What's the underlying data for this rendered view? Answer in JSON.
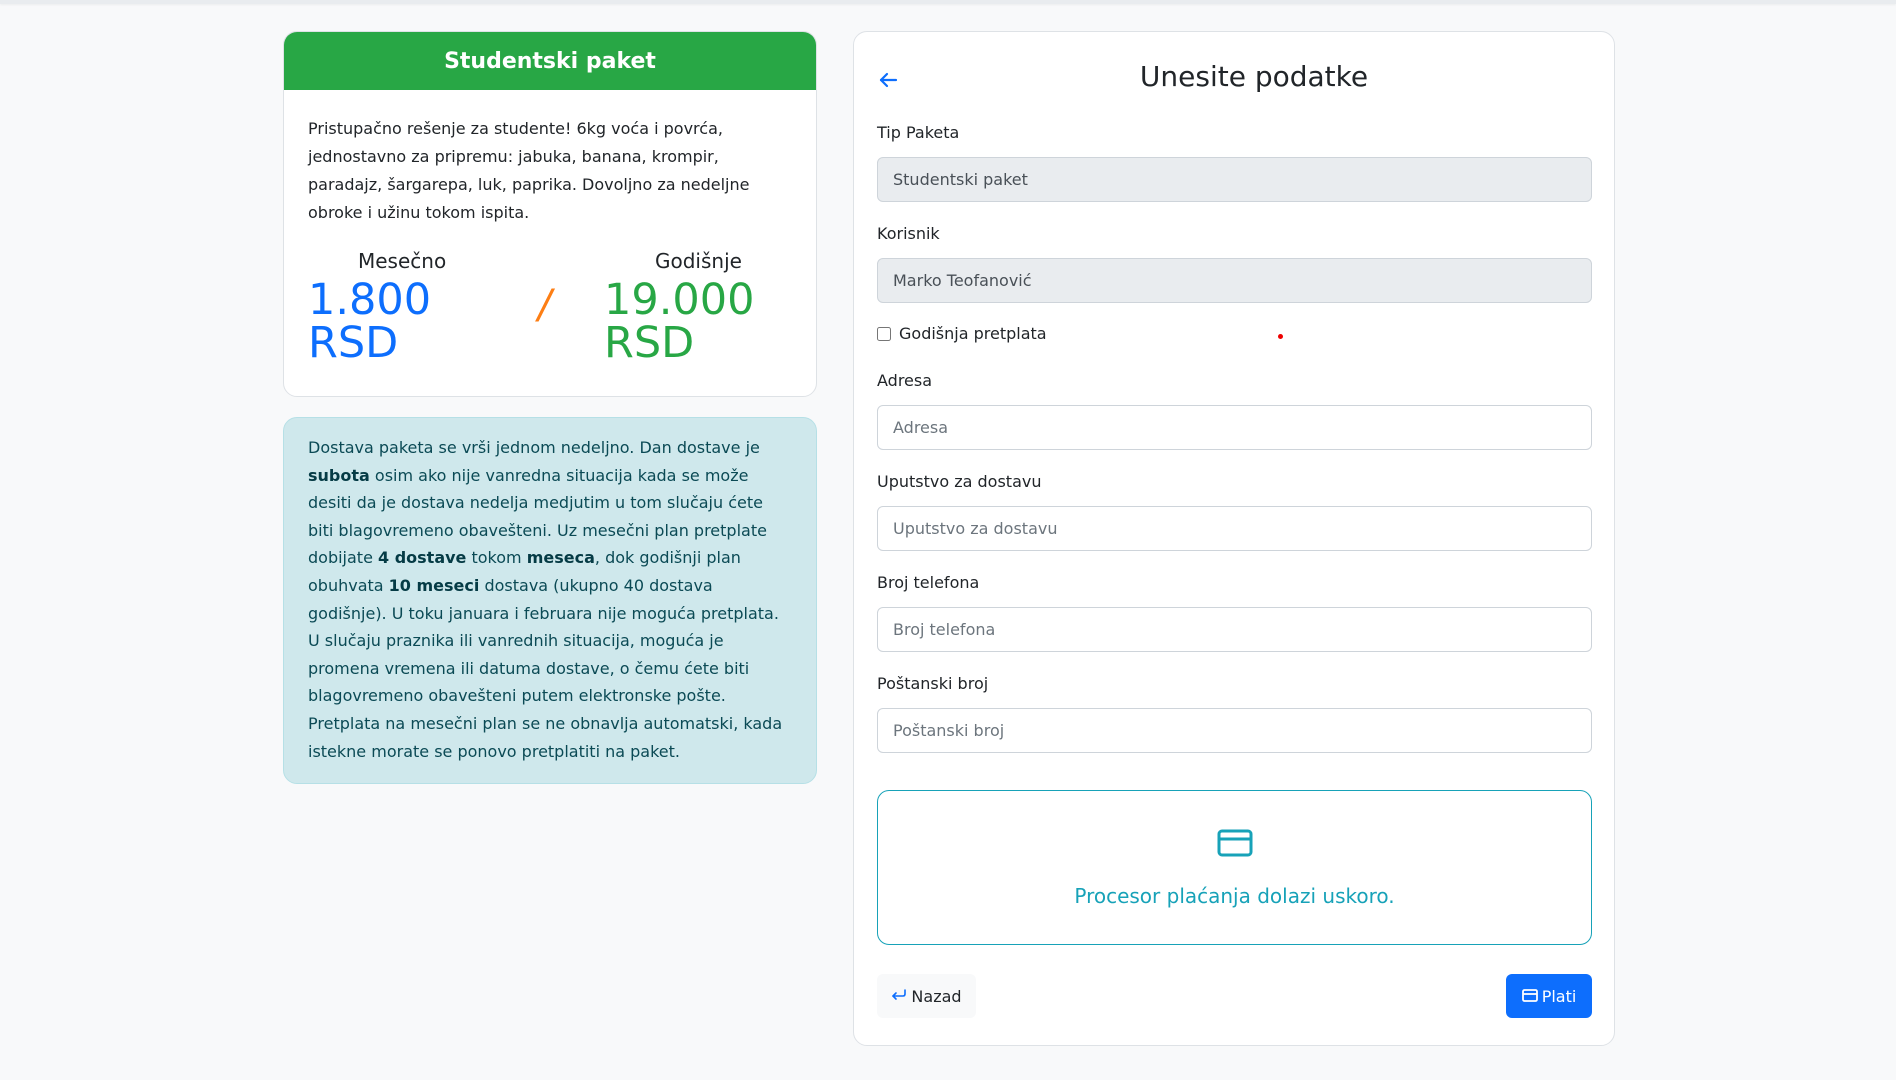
{
  "package": {
    "title": "Studentski paket",
    "description": "Pristupačno rešenje za studente! 6kg voća i povrća, jednostavno za pripremu: jabuka, banana, krompir, paradajz, šargarepa, luk, paprika. Dovoljno za nedeljne obroke i užinu tokom ispita.",
    "monthly_label": "Mesečno",
    "monthly_amount": "1.800",
    "monthly_currency": "RSD",
    "separator": "/",
    "yearly_label": "Godišnje",
    "yearly_amount": "19.000",
    "yearly_currency": "RSD"
  },
  "delivery_info": {
    "p1": "Dostava paketa se vrši jednom nedeljno. Dan dostave je ",
    "b1": "subota",
    "p2": " osim ako nije vanredna situacija kada se može desiti da je dostava nedelja medjutim u tom slučaju ćete biti blagovremeno obavešteni. Uz mesečni plan pretplate dobijate ",
    "b2": "4 dostave",
    "p3": " tokom ",
    "b3": "meseca",
    "p4": ", dok godišnji plan obuhvata ",
    "b4": "10 meseci",
    "p5": " dostava (ukupno 40 dostava godišnje). U toku januara i februara nije moguća pretplata. U slučaju praznika ili vanrednih situacija, moguća je promena vremena ili datuma dostave, o čemu ćete biti blagovremeno obavešteni putem elektronske pošte. Pretplata na mesečni plan se ne obnavlja automatski, kada istekne morate se ponovo pretplatiti na paket."
  },
  "form": {
    "title": "Unesite podatke",
    "package_type_label": "Tip Paketa",
    "package_type_value": "Studentski paket",
    "user_label": "Korisnik",
    "user_value": "Marko Teofanović",
    "yearly_checkbox_label": "Godišnja pretplata",
    "yearly_checked": false,
    "address_label": "Adresa",
    "address_placeholder": "Adresa",
    "delivery_instructions_label": "Uputstvo za dostavu",
    "delivery_instructions_placeholder": "Uputstvo za dostavu",
    "phone_label": "Broj telefona",
    "phone_placeholder": "Broj telefona",
    "postal_label": "Poštanski broj",
    "postal_placeholder": "Poštanski broj",
    "payment_message": "Procesor plaćanja dolazi uskoro.",
    "back_button": "Nazad",
    "pay_button": "Plati"
  },
  "colors": {
    "header_green": "#28a745",
    "monthly_blue": "#0d6efd",
    "yearly_green": "#28a745",
    "slash_orange": "#fd7e14",
    "info_bg": "#cfe8ec",
    "payment_teal": "#17a2b8",
    "pay_button_blue": "#0d6efd"
  },
  "icons": {
    "back": "arrow-left-icon",
    "card": "credit-card-icon",
    "return": "return-arrow-icon"
  }
}
